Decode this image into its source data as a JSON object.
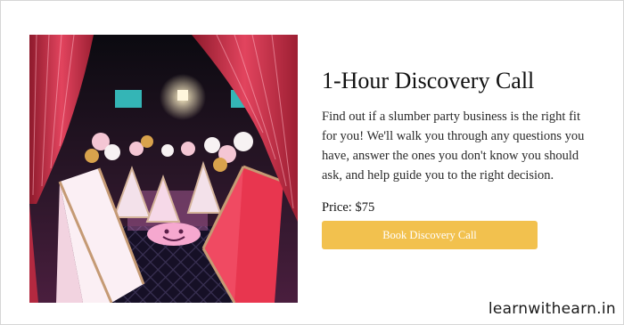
{
  "card": {
    "image_alt": "Slumber party setup with teepee tents, balloons and tinsel curtains",
    "title": "1-Hour Discovery Call",
    "description": "Find out if a slumber party business is the right fit for you! We'll walk you through any questions you have, answer the ones you don't know you should ask, and help guide you to the right decision.",
    "price": "Price: $75",
    "cta_label": "Book Discovery Call"
  },
  "watermark": "learnwithearn.in",
  "colors": {
    "button": "#f2c14e",
    "button_text": "#ffffff",
    "title": "#111111",
    "border": "#d6d6d6"
  }
}
